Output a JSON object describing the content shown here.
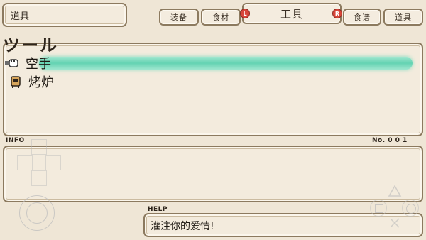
{
  "header": {
    "category_label": "道具",
    "current_tab": "工具",
    "left_trigger": "L",
    "right_trigger": "R",
    "tabs_left": [
      "装备",
      "食材"
    ],
    "tabs_right": [
      "食谱",
      "道具"
    ]
  },
  "list": {
    "title": "ツール",
    "items": [
      {
        "label": "空手",
        "icon": "hand-icon",
        "selected": true
      },
      {
        "label": "烤炉",
        "icon": "stove-icon",
        "selected": false
      }
    ]
  },
  "info": {
    "label": "INFO",
    "number": "No. 0 0 1"
  },
  "help": {
    "label": "HELP",
    "text": "灌注你的爱情!"
  },
  "colors": {
    "selection": "#64d3b2",
    "frame": "#8c7a5f",
    "badge": "#d8463a"
  }
}
